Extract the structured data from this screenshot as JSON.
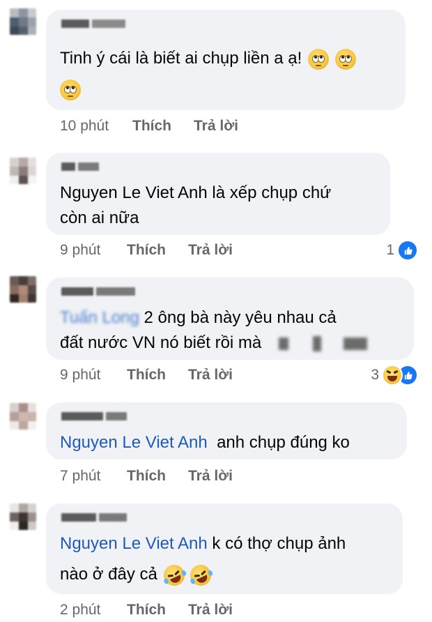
{
  "comments": [
    {
      "text_line1": "Tinh ý cái là biết ai chụp liền a ạ!",
      "emoji": "face-with-rolling-eyes-icon",
      "time": "10 phút",
      "like": "Thích",
      "reply": "Trả lời"
    },
    {
      "text_line1": "Nguyen Le Viet Anh là xếp  chụp chứ",
      "text_line2": "còn ai nữa",
      "time": "9 phút",
      "like": "Thích",
      "reply": "Trả lời",
      "reaction_count": "1",
      "reaction": "like-icon"
    },
    {
      "mention": "Tuấn Long",
      "text_line1": " 2 ông bà này yêu nhau cả",
      "text_line2": "đất nước VN nó biết rồi mà",
      "time": "9 phút",
      "like": "Thích",
      "reply": "Trả lời",
      "reaction_count": "3",
      "reaction": "haha-and-like-icons"
    },
    {
      "mention": "Nguyen Le Viet Anh",
      "text_line1": "  anh chụp đúng ko",
      "time": "7 phút",
      "like": "Thích",
      "reply": "Trả lời"
    },
    {
      "mention": "Nguyen Le Viet Anh",
      "text_line1": " k có thợ chụp ảnh",
      "text_line2": "nào ở đây cả",
      "emoji": "rolling-on-floor-laughing-icon",
      "time": "2 phút",
      "like": "Thích",
      "reply": "Trả lời"
    }
  ],
  "colors": {
    "bubble": "#f0f2f5",
    "mention": "#1f5ab8",
    "meta": "#65676b",
    "like_blue": "#1877f2"
  }
}
